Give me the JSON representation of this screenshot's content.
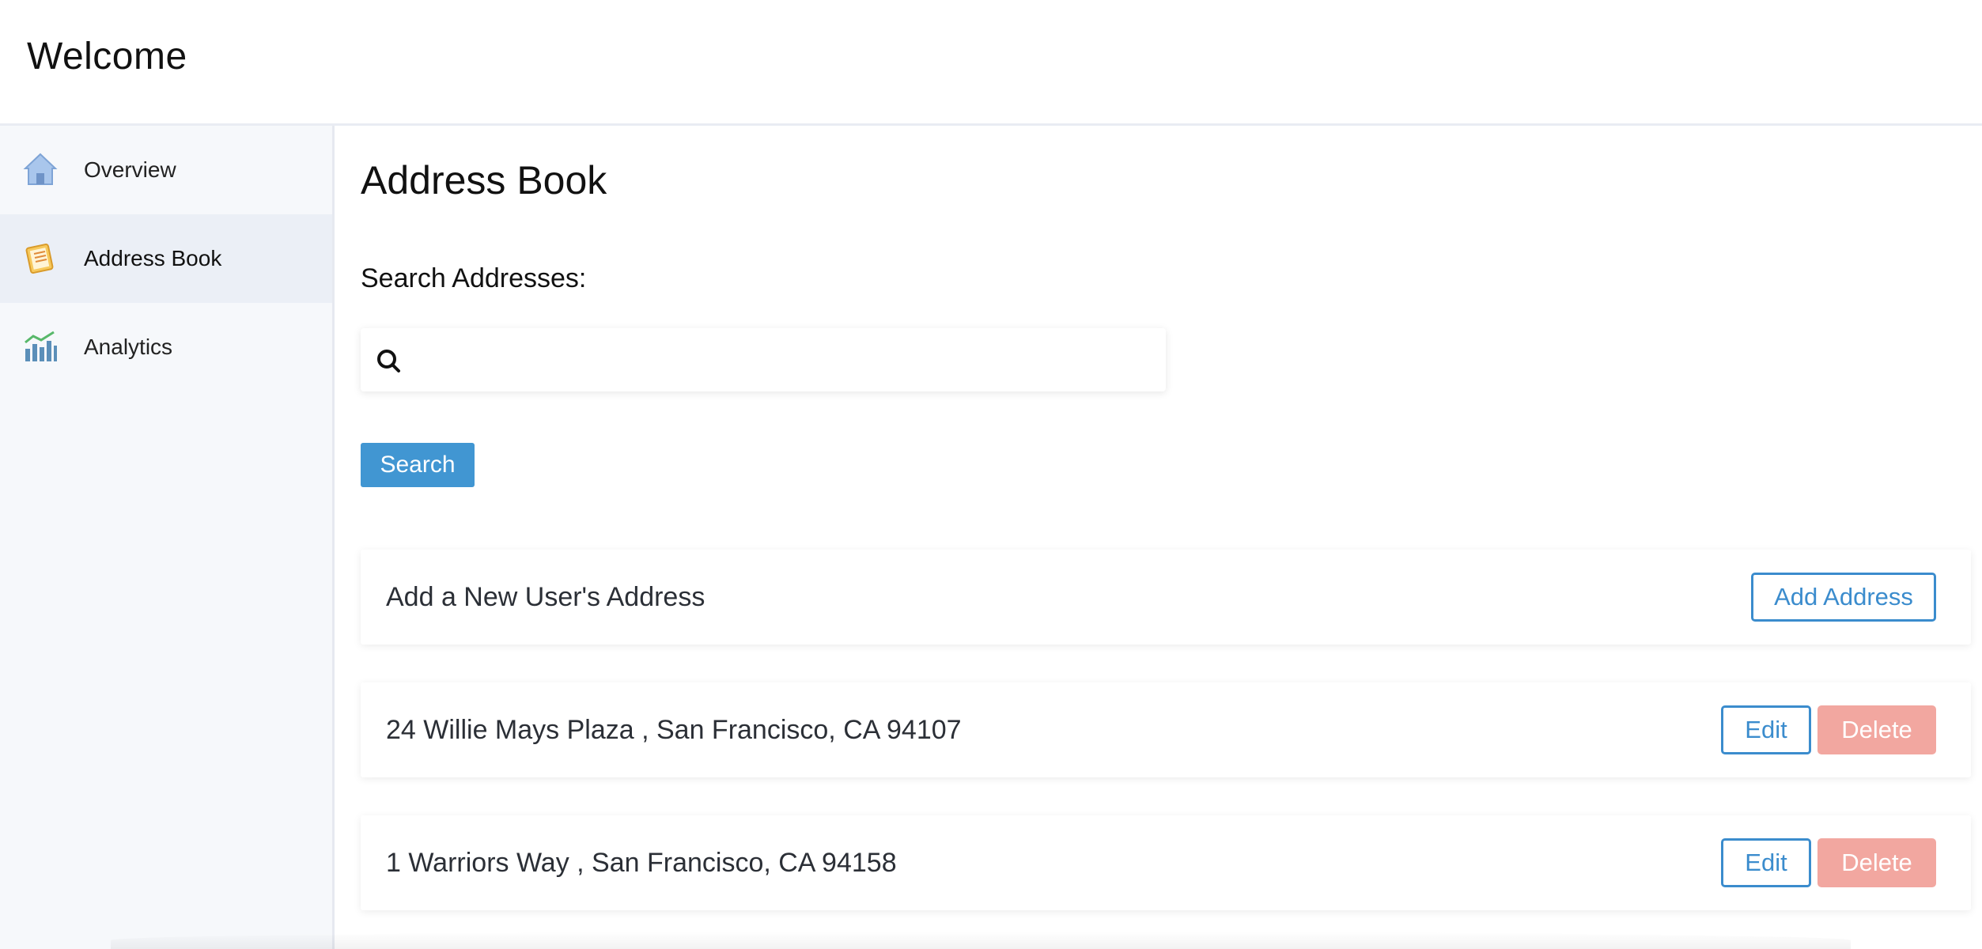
{
  "header": {
    "title": "Welcome"
  },
  "sidebar": {
    "items": [
      {
        "label": "Overview",
        "icon": "house-icon",
        "active": false
      },
      {
        "label": "Address Book",
        "icon": "address-book-icon",
        "active": true
      },
      {
        "label": "Analytics",
        "icon": "analytics-chart-icon",
        "active": false
      }
    ]
  },
  "main": {
    "title": "Address Book",
    "search": {
      "label": "Search Addresses:",
      "value": "",
      "placeholder": "",
      "button_label": "Search"
    },
    "add_card": {
      "text": "Add a New User's Address",
      "button_label": "Add Address"
    },
    "addresses": [
      {
        "text": "24 Willie Mays Plaza , San Francisco, CA 94107",
        "edit_label": "Edit",
        "delete_label": "Delete"
      },
      {
        "text": "1 Warriors Way , San Francisco, CA 94158",
        "edit_label": "Edit",
        "delete_label": "Delete"
      }
    ]
  },
  "colors": {
    "primary_blue": "#4196d2",
    "outline_blue": "#3b8ccd",
    "delete_red": "#f2a7a0",
    "sidebar_bg": "#f6f8fb",
    "sidebar_active_bg": "#ebeff6"
  }
}
